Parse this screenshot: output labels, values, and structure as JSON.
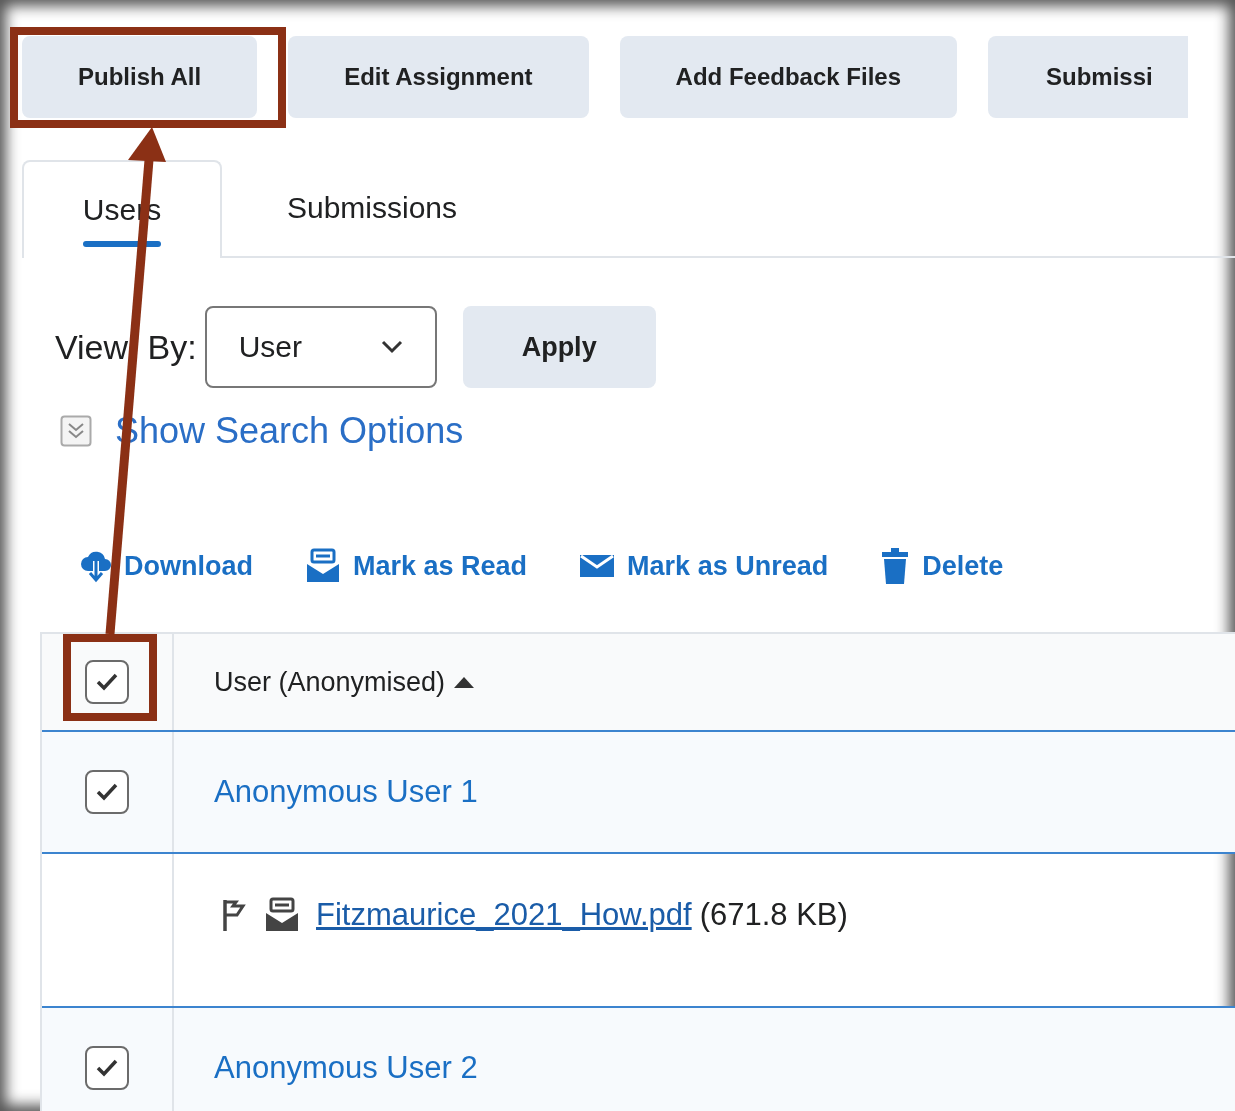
{
  "toolbar": {
    "buttons": [
      {
        "label": "Publish All"
      },
      {
        "label": "Edit Assignment"
      },
      {
        "label": "Add Feedback Files"
      },
      {
        "label": "Submissi"
      }
    ]
  },
  "tabs": [
    {
      "label": "Users",
      "selected": true
    },
    {
      "label": "Submissions",
      "selected": false
    }
  ],
  "view_by": {
    "label": "View By:",
    "value": "User",
    "apply": "Apply"
  },
  "search_options": {
    "label": "Show Search Options",
    "expanded": false
  },
  "actions": [
    {
      "kind": "download",
      "label": "Download"
    },
    {
      "kind": "read",
      "label": "Mark as Read"
    },
    {
      "kind": "unread",
      "label": "Mark as Unread"
    },
    {
      "kind": "delete",
      "label": "Delete"
    }
  ],
  "table": {
    "header": {
      "label": "User (Anonymised)",
      "checked": true
    },
    "rows": [
      {
        "kind": "user",
        "name": "Anonymous User 1",
        "checked": true,
        "selected": true
      },
      {
        "kind": "file",
        "file_name": "Fitzmaurice_2021_How.pdf",
        "size": "(671.8 KB)"
      },
      {
        "kind": "user",
        "name": "Anonymous User 2",
        "checked": true,
        "selected": true
      }
    ]
  }
}
